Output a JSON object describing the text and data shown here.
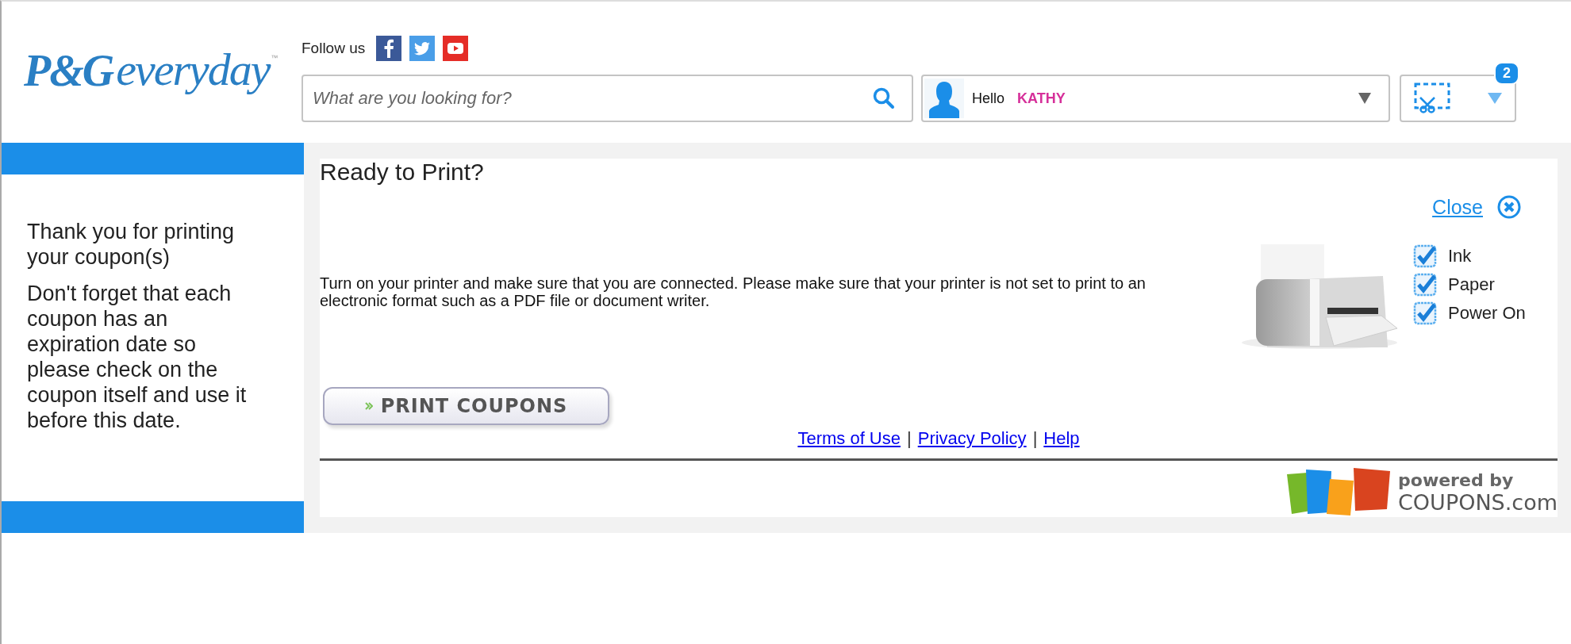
{
  "header": {
    "logo": {
      "brand": "P&G",
      "word": "everyday",
      "mark": "™"
    },
    "follow_label": "Follow us",
    "social": [
      {
        "kind": "facebook",
        "color": "#3b5998"
      },
      {
        "kind": "twitter",
        "color": "#4a9ee8"
      },
      {
        "kind": "youtube",
        "color": "#e52d27"
      }
    ],
    "search": {
      "placeholder": "What are you looking for?"
    },
    "user": {
      "greeting": "Hello",
      "name": "KATHY"
    },
    "clip_count": "2"
  },
  "sidebar": {
    "messages": [
      "Thank you for printing your coupon(s)",
      "Don't forget that each coupon has an expiration date so please check on the coupon itself and use it before this date."
    ]
  },
  "dialog": {
    "title": "Ready to Print?",
    "close_label": "Close",
    "instructions": "Turn on your printer and make sure that you are connected. Please make sure that your printer is not set to print to an electronic format such as a PDF file or document writer.",
    "checklist": [
      {
        "label": "Ink",
        "checked": true
      },
      {
        "label": "Paper",
        "checked": true
      },
      {
        "label": "Power On",
        "checked": true
      }
    ],
    "print_button": "PRINT COUPONS",
    "footer_items": [
      {
        "kind": "link",
        "text": "Terms of Use"
      },
      {
        "kind": "separator",
        "text": "|"
      },
      {
        "kind": "link",
        "text": "Privacy Policy"
      },
      {
        "kind": "separator",
        "text": "|"
      },
      {
        "kind": "link",
        "text": "Help"
      }
    ],
    "powered": {
      "tagline": "powered by",
      "name": "COUPONS.com"
    }
  }
}
